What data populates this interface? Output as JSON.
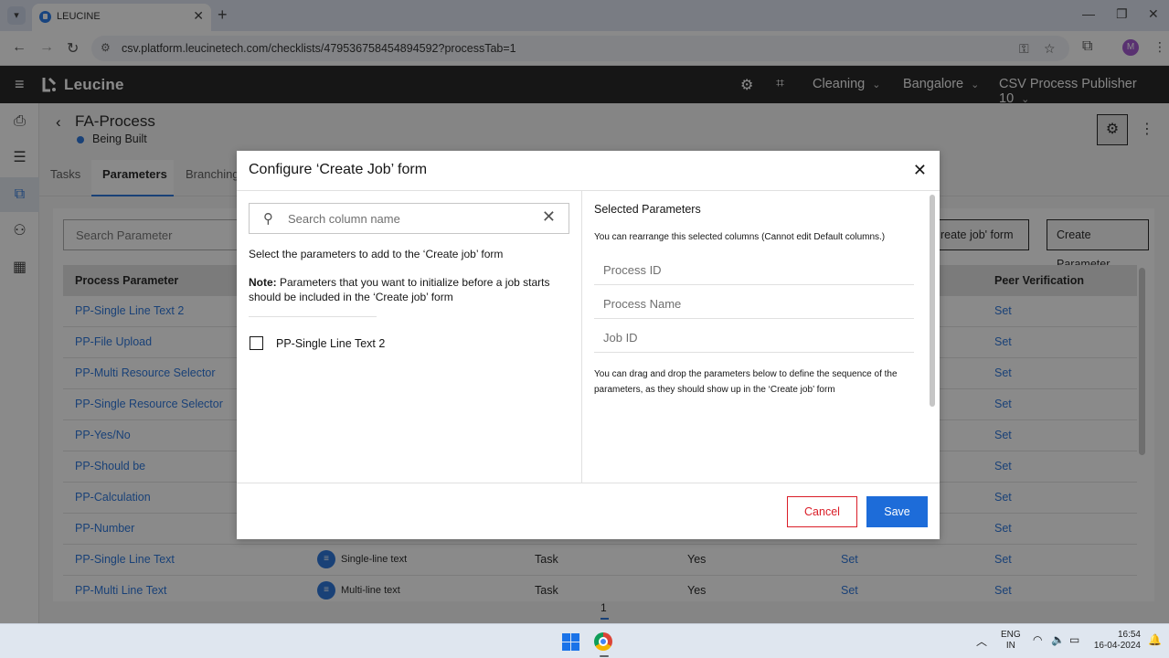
{
  "browser": {
    "tab_title": "LEUCINE",
    "url": "csv.platform.leucinetech.com/checklists/479536758454894592?processTab=1",
    "profile_initial": "M"
  },
  "app_header": {
    "brand": "Leucine",
    "facility": "Cleaning",
    "location": "Bangalore",
    "user_role": "CSV Process Publisher 10"
  },
  "page": {
    "title": "FA-Process",
    "status": "Being Built",
    "tabs": [
      "Tasks",
      "Parameters",
      "Branching"
    ],
    "active_tab": "Parameters",
    "search_placeholder": "Search Parameter",
    "configure_button": "reate job' form",
    "create_button": "Create Parameter",
    "table": {
      "headers": [
        "Process Parameter",
        "Peer Verification"
      ],
      "rows": [
        {
          "name": "PP-Single Line Text 2",
          "peer": "Set"
        },
        {
          "name": "PP-File Upload",
          "peer": "Set"
        },
        {
          "name": "PP-Multi Resource Selector",
          "peer": "Set"
        },
        {
          "name": "PP-Single Resource Selector",
          "peer": "Set"
        },
        {
          "name": "PP-Yes/No",
          "peer": "Set"
        },
        {
          "name": "PP-Should be",
          "peer": "Set"
        },
        {
          "name": "PP-Calculation",
          "peer": "Set"
        },
        {
          "name": "PP-Number",
          "peer": "Set"
        },
        {
          "name": "PP-Single Line Text",
          "type": "Single-line text",
          "target": "Task",
          "mandatory": "Yes",
          "verification": "Set",
          "peer": "Set"
        },
        {
          "name": "PP-Multi Line Text",
          "type": "Multi-line text",
          "target": "Task",
          "mandatory": "Yes",
          "verification": "Set",
          "peer": "Set"
        }
      ]
    },
    "pagination_page": "1"
  },
  "modal": {
    "title": "Configure ‘Create Job’ form",
    "search_placeholder": "Search column name",
    "instruction": "Select the parameters to add to the ‘Create job’ form",
    "note_label": "Note:",
    "note_text": " Parameters that you want to initialize before a job starts should be included in the ‘Create job’ form",
    "available_parameters": [
      {
        "label": "PP-Single Line Text 2",
        "checked": false
      }
    ],
    "selected_title": "Selected Parameters",
    "selected_subtitle": "You can rearrange this selected columns (Cannot edit Default columns.)",
    "default_columns": [
      "Process ID",
      "Process Name",
      "Job ID"
    ],
    "drag_note": "You can drag and drop the parameters below to define the sequence of the parameters, as they should show up in the ‘Create job’ form",
    "cancel_label": "Cancel",
    "save_label": "Save"
  },
  "taskbar": {
    "lang_line1": "ENG",
    "lang_line2": "IN",
    "time": "16:54",
    "date": "16-04-2024"
  }
}
